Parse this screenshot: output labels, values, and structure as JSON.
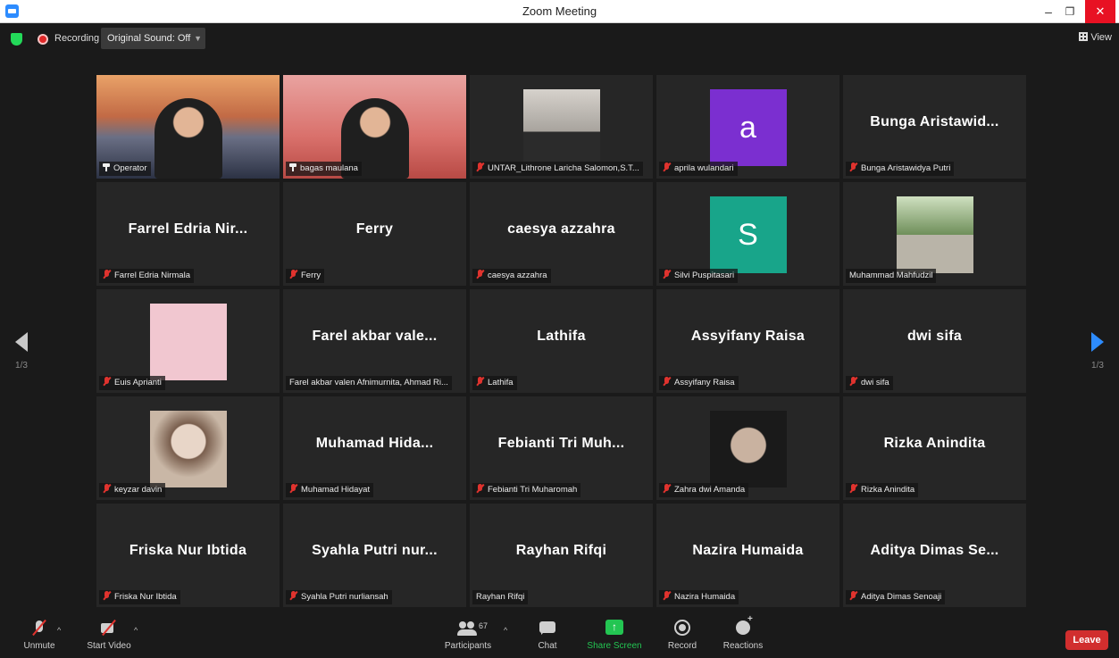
{
  "window": {
    "title": "Zoom Meeting",
    "minimize": "–",
    "maximize": "❐",
    "close": "✕"
  },
  "topbar": {
    "recording": "Recording",
    "original_sound": "Original Sound: Off",
    "view": "View"
  },
  "nav": {
    "page_left": "1/3",
    "page_right": "1/3"
  },
  "tiles": [
    {
      "name": "Operator",
      "label": "Operator",
      "kind": "video",
      "muted": false,
      "active": true
    },
    {
      "name": "bagas maulana",
      "label": "bagas maulana",
      "kind": "video",
      "muted": false
    },
    {
      "name": "UNTAR_Lithrone Laricha Salomon,S.T...",
      "label": "UNTAR_Lithrone Laricha Salomon,S.T...",
      "kind": "photo",
      "muted": true
    },
    {
      "name": "aprila wulandari",
      "label": "aprila wulandari",
      "kind": "letter",
      "letter": "a",
      "color": "#7b2fd0",
      "muted": true
    },
    {
      "name": "Bunga Aristawid...",
      "label": "Bunga Aristawidya Putri",
      "kind": "text",
      "muted": true
    },
    {
      "name": "Farrel Edria Nir...",
      "label": "Farrel Edria Nirmala",
      "kind": "text",
      "muted": true
    },
    {
      "name": "Ferry",
      "label": "Ferry",
      "kind": "text",
      "muted": true
    },
    {
      "name": "caesya azzahra",
      "label": "caesya azzahra",
      "kind": "text",
      "muted": true
    },
    {
      "name": "Silvi Puspitasari",
      "label": "Silvi Puspitasari",
      "kind": "letter",
      "letter": "S",
      "color": "#18a58a",
      "muted": true
    },
    {
      "name": "Muhammad Mahfudzil",
      "label": "Muhammad Mahfudzil",
      "kind": "photo",
      "muted": false
    },
    {
      "name": "Euis Aprianti",
      "label": "Euis Aprianti",
      "kind": "photo",
      "muted": true
    },
    {
      "name": "Farel akbar vale...",
      "label": "Farel akbar valen Afnimurnita, Ahmad Ri...",
      "kind": "text",
      "muted": false
    },
    {
      "name": "Lathifa",
      "label": "Lathifa",
      "kind": "text",
      "muted": true
    },
    {
      "name": "Assyifany Raisa",
      "label": "Assyifany Raisa",
      "kind": "text",
      "muted": true
    },
    {
      "name": "dwi sifa",
      "label": "dwi sifa",
      "kind": "text",
      "muted": true
    },
    {
      "name": "keyzar davin",
      "label": "keyzar davin",
      "kind": "photo",
      "muted": true
    },
    {
      "name": "Muhamad Hida...",
      "label": "Muhamad Hidayat",
      "kind": "text",
      "muted": true
    },
    {
      "name": "Febianti Tri Muh...",
      "label": "Febianti Tri Muharomah",
      "kind": "text",
      "muted": true
    },
    {
      "name": "Zahra dwi Amanda",
      "label": "Zahra dwi Amanda",
      "kind": "photo",
      "muted": true
    },
    {
      "name": "Rizka Anindita",
      "label": "Rizka Anindita",
      "kind": "text",
      "muted": true
    },
    {
      "name": "Friska Nur Ibtida",
      "label": "Friska Nur Ibtida",
      "kind": "text",
      "muted": true
    },
    {
      "name": "Syahla Putri nur...",
      "label": "Syahla Putri nurliansah",
      "kind": "text",
      "muted": true
    },
    {
      "name": "Rayhan Rifqi",
      "label": "Rayhan Rifqi",
      "kind": "text",
      "muted": false
    },
    {
      "name": "Nazira Humaida",
      "label": "Nazira Humaida",
      "kind": "text",
      "muted": true
    },
    {
      "name": "Aditya Dimas Se...",
      "label": "Aditya Dimas Senoaji",
      "kind": "text",
      "muted": true
    }
  ],
  "toolbar": {
    "unmute": "Unmute",
    "start_video": "Start Video",
    "participants": "Participants",
    "participant_count": "67",
    "chat": "Chat",
    "share_screen": "Share Screen",
    "record": "Record",
    "reactions": "Reactions",
    "leave": "Leave"
  },
  "colors": {
    "accent": "#2d8cff",
    "share": "#23c552",
    "leave": "#d12e2e",
    "active_speaker": "#d7ef6a"
  }
}
